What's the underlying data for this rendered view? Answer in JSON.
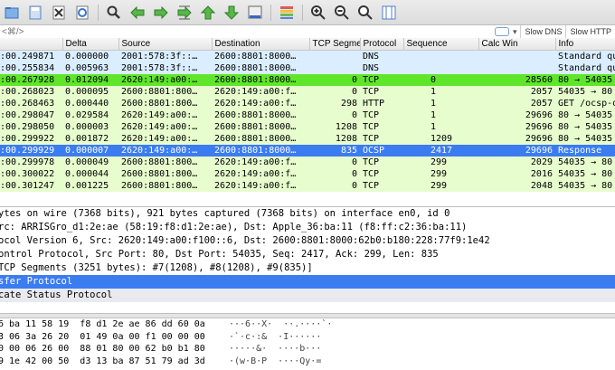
{
  "toolbar": {
    "icons": [
      "open-file-icon",
      "save-file-icon",
      "close-file-icon",
      "reload-icon",
      "find-packet-icon",
      "go-back-icon",
      "go-forward-icon",
      "go-to-packet-icon",
      "first-packet-icon",
      "last-packet-icon",
      "autoscroll-icon",
      "colorize-icon",
      "zoom-in-icon",
      "zoom-out-icon",
      "normal-size-icon",
      "resize-columns-icon"
    ]
  },
  "filter": {
    "placeholder": "<⌘/>",
    "buttons": [
      "Slow DNS",
      "Slow HTTP"
    ]
  },
  "columns": [
    "",
    "Delta",
    "Source",
    "Destination",
    "TCP Segme",
    "Protocol",
    "Sequence",
    "Calc Win",
    "Info"
  ],
  "packets": [
    {
      "style": "dns",
      "time": ":00.249871",
      "delta": "0.000000",
      "src": "2001:578:3f::…",
      "dst": "2600:8801:8000…",
      "seg": "",
      "proto": "DNS",
      "seq": "",
      "win": "",
      "info": "Standard qu"
    },
    {
      "style": "dns",
      "time": ":00.255834",
      "delta": "0.005963",
      "src": "2001:578:3f::…",
      "dst": "2600:8801:8000…",
      "seg": "",
      "proto": "DNS",
      "seq": "",
      "win": "",
      "info": "Standard qu"
    },
    {
      "style": "tcpsel",
      "time": ":00.267928",
      "delta": "0.012094",
      "src": "2620:149:a00:…",
      "dst": "2600:8801:8000…",
      "seg": "0",
      "proto": "TCP",
      "seq": "0",
      "win": "28560",
      "info": "80 → 54035"
    },
    {
      "style": "tcp",
      "time": ":00.268023",
      "delta": "0.000095",
      "src": "2600:8801:800…",
      "dst": "2620:149:a00:f…",
      "seg": "0",
      "proto": "TCP",
      "seq": "1",
      "win": "2057",
      "info": "54035 → 80"
    },
    {
      "style": "tcp",
      "time": ":00.268463",
      "delta": "0.000440",
      "src": "2600:8801:800…",
      "dst": "2620:149:a00:f…",
      "seg": "298",
      "proto": "HTTP",
      "seq": "1",
      "win": "2057",
      "info": "GET /ocsp-d"
    },
    {
      "style": "tcp",
      "time": ":00.298047",
      "delta": "0.029584",
      "src": "2620:149:a00:…",
      "dst": "2600:8801:8000…",
      "seg": "0",
      "proto": "TCP",
      "seq": "1",
      "win": "29696",
      "info": "80 → 54035"
    },
    {
      "style": "tcp",
      "time": ":00.298050",
      "delta": "0.000003",
      "src": "2620:149:a00:…",
      "dst": "2600:8801:8000…",
      "seg": "1208",
      "proto": "TCP",
      "seq": "1",
      "win": "29696",
      "info": "80 → 54035"
    },
    {
      "style": "tcp",
      "time": ":00.299922",
      "delta": "0.001872",
      "src": "2620:149:a00:…",
      "dst": "2600:8801:8000…",
      "seg": "1208",
      "proto": "TCP",
      "seq": "1209",
      "win": "29696",
      "info": "80 → 54035"
    },
    {
      "style": "sel",
      "time": ":00.299929",
      "delta": "0.000007",
      "src": "2620:149:a00:…",
      "dst": "2600:8801:8000…",
      "seg": "835",
      "proto": "OCSP",
      "seq": "2417",
      "win": "29696",
      "info": "Response"
    },
    {
      "style": "tcp",
      "time": ":00.299978",
      "delta": "0.000049",
      "src": "2600:8801:800…",
      "dst": "2620:149:a00:f…",
      "seg": "0",
      "proto": "TCP",
      "seq": "299",
      "win": "2029",
      "info": "54035 → 80"
    },
    {
      "style": "tcp",
      "time": ":00.300022",
      "delta": "0.000044",
      "src": "2600:8801:800…",
      "dst": "2620:149:a00:f…",
      "seg": "0",
      "proto": "TCP",
      "seq": "299",
      "win": "2016",
      "info": "54035 → 80"
    },
    {
      "style": "tcp",
      "time": ":00.301247",
      "delta": "0.001225",
      "src": "2600:8801:800…",
      "dst": "2620:149:a00:f…",
      "seg": "0",
      "proto": "TCP",
      "seq": "299",
      "win": "2048",
      "info": "54035 → 80"
    }
  ],
  "details": [
    {
      "style": "",
      "text": "ytes on wire (7368 bits), 921 bytes captured (7368 bits) on interface en0, id 0"
    },
    {
      "style": "",
      "text": "rc: ARRISGro_d1:2e:ae (58:19:f8:d1:2e:ae), Dst: Apple_36:ba:11 (f8:ff:c2:36:ba:11)"
    },
    {
      "style": "",
      "text": "ocol Version 6, Src: 2620:149:a00:f100::6, Dst: 2600:8801:8000:62b0:b180:228:77f9:1e42"
    },
    {
      "style": "",
      "text": "ontrol Protocol, Src Port: 80, Dst Port: 54035, Seq: 2417, Ack: 299, Len: 835"
    },
    {
      "style": "",
      "text": " TCP Segments (3251 bytes): #7(1208), #8(1208), #9(835)]"
    },
    {
      "style": "hl",
      "text": "sfer Protocol"
    },
    {
      "style": "alt",
      "text": "cate Status Protocol"
    }
  ],
  "hex": [
    {
      "bytes": "6 ba 11 58 19  f8 d1 2e ae 86 dd 60 0a",
      "ascii": "···6··X·  ··.····`·"
    },
    {
      "bytes": "3 06 3a 26 20  01 49 0a 00 f1 00 00 00",
      "ascii": "·`·c·:&  ·I······"
    },
    {
      "bytes": "0 00 06 26 00  88 01 80 00 62 b0 b1 80",
      "ascii": "·····&·  ····b···"
    },
    {
      "bytes": "9 1e 42 00 50  d3 13 ba 87 51 79 ad 3d",
      "ascii": "·(w·B·P  ····Qy·="
    }
  ]
}
